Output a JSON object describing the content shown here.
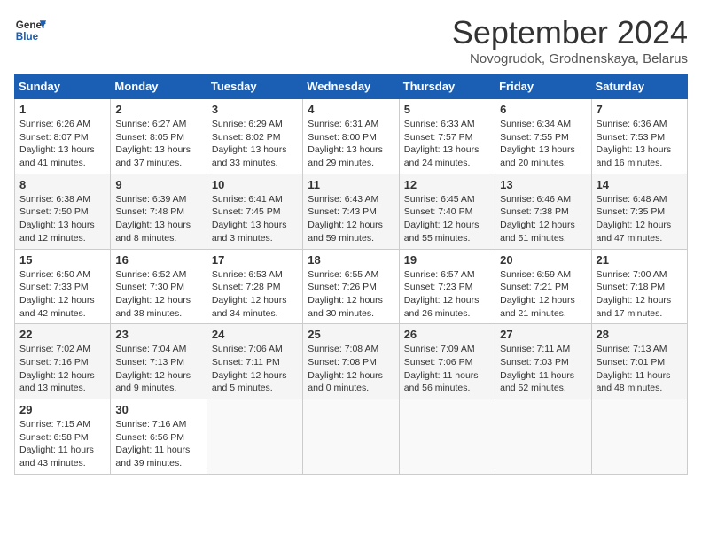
{
  "header": {
    "logo_line1": "General",
    "logo_line2": "Blue",
    "month_title": "September 2024",
    "subtitle": "Novogrudok, Grodnenskaya, Belarus"
  },
  "weekdays": [
    "Sunday",
    "Monday",
    "Tuesday",
    "Wednesday",
    "Thursday",
    "Friday",
    "Saturday"
  ],
  "days": [
    {
      "num": "",
      "info": ""
    },
    {
      "num": "",
      "info": ""
    },
    {
      "num": "",
      "info": ""
    },
    {
      "num": "",
      "info": ""
    },
    {
      "num": "",
      "info": ""
    },
    {
      "num": "",
      "info": ""
    },
    {
      "num": "1",
      "sunrise": "6:26 AM",
      "sunset": "8:07 PM",
      "daylight": "13 hours and 41 minutes"
    },
    {
      "num": "2",
      "sunrise": "6:27 AM",
      "sunset": "8:05 PM",
      "daylight": "13 hours and 37 minutes"
    },
    {
      "num": "3",
      "sunrise": "6:29 AM",
      "sunset": "8:02 PM",
      "daylight": "13 hours and 33 minutes"
    },
    {
      "num": "4",
      "sunrise": "6:31 AM",
      "sunset": "8:00 PM",
      "daylight": "13 hours and 29 minutes"
    },
    {
      "num": "5",
      "sunrise": "6:33 AM",
      "sunset": "7:57 PM",
      "daylight": "13 hours and 24 minutes"
    },
    {
      "num": "6",
      "sunrise": "6:34 AM",
      "sunset": "7:55 PM",
      "daylight": "13 hours and 20 minutes"
    },
    {
      "num": "7",
      "sunrise": "6:36 AM",
      "sunset": "7:53 PM",
      "daylight": "13 hours and 16 minutes"
    },
    {
      "num": "8",
      "sunrise": "6:38 AM",
      "sunset": "7:50 PM",
      "daylight": "13 hours and 12 minutes"
    },
    {
      "num": "9",
      "sunrise": "6:39 AM",
      "sunset": "7:48 PM",
      "daylight": "13 hours and 8 minutes"
    },
    {
      "num": "10",
      "sunrise": "6:41 AM",
      "sunset": "7:45 PM",
      "daylight": "13 hours and 3 minutes"
    },
    {
      "num": "11",
      "sunrise": "6:43 AM",
      "sunset": "7:43 PM",
      "daylight": "12 hours and 59 minutes"
    },
    {
      "num": "12",
      "sunrise": "6:45 AM",
      "sunset": "7:40 PM",
      "daylight": "12 hours and 55 minutes"
    },
    {
      "num": "13",
      "sunrise": "6:46 AM",
      "sunset": "7:38 PM",
      "daylight": "12 hours and 51 minutes"
    },
    {
      "num": "14",
      "sunrise": "6:48 AM",
      "sunset": "7:35 PM",
      "daylight": "12 hours and 47 minutes"
    },
    {
      "num": "15",
      "sunrise": "6:50 AM",
      "sunset": "7:33 PM",
      "daylight": "12 hours and 42 minutes"
    },
    {
      "num": "16",
      "sunrise": "6:52 AM",
      "sunset": "7:30 PM",
      "daylight": "12 hours and 38 minutes"
    },
    {
      "num": "17",
      "sunrise": "6:53 AM",
      "sunset": "7:28 PM",
      "daylight": "12 hours and 34 minutes"
    },
    {
      "num": "18",
      "sunrise": "6:55 AM",
      "sunset": "7:26 PM",
      "daylight": "12 hours and 30 minutes"
    },
    {
      "num": "19",
      "sunrise": "6:57 AM",
      "sunset": "7:23 PM",
      "daylight": "12 hours and 26 minutes"
    },
    {
      "num": "20",
      "sunrise": "6:59 AM",
      "sunset": "7:21 PM",
      "daylight": "12 hours and 21 minutes"
    },
    {
      "num": "21",
      "sunrise": "7:00 AM",
      "sunset": "7:18 PM",
      "daylight": "12 hours and 17 minutes"
    },
    {
      "num": "22",
      "sunrise": "7:02 AM",
      "sunset": "7:16 PM",
      "daylight": "12 hours and 13 minutes"
    },
    {
      "num": "23",
      "sunrise": "7:04 AM",
      "sunset": "7:13 PM",
      "daylight": "12 hours and 9 minutes"
    },
    {
      "num": "24",
      "sunrise": "7:06 AM",
      "sunset": "7:11 PM",
      "daylight": "12 hours and 5 minutes"
    },
    {
      "num": "25",
      "sunrise": "7:08 AM",
      "sunset": "7:08 PM",
      "daylight": "12 hours and 0 minutes"
    },
    {
      "num": "26",
      "sunrise": "7:09 AM",
      "sunset": "7:06 PM",
      "daylight": "11 hours and 56 minutes"
    },
    {
      "num": "27",
      "sunrise": "7:11 AM",
      "sunset": "7:03 PM",
      "daylight": "11 hours and 52 minutes"
    },
    {
      "num": "28",
      "sunrise": "7:13 AM",
      "sunset": "7:01 PM",
      "daylight": "11 hours and 48 minutes"
    },
    {
      "num": "29",
      "sunrise": "7:15 AM",
      "sunset": "6:58 PM",
      "daylight": "11 hours and 43 minutes"
    },
    {
      "num": "30",
      "sunrise": "7:16 AM",
      "sunset": "6:56 PM",
      "daylight": "11 hours and 39 minutes"
    },
    {
      "num": "",
      "info": ""
    },
    {
      "num": "",
      "info": ""
    },
    {
      "num": "",
      "info": ""
    },
    {
      "num": "",
      "info": ""
    },
    {
      "num": "",
      "info": ""
    }
  ]
}
